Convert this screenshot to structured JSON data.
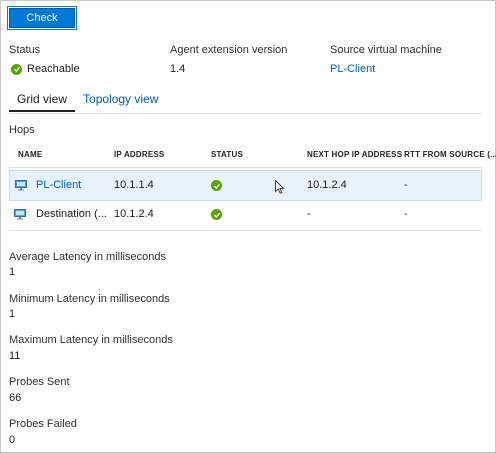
{
  "check_button": "Check",
  "info": {
    "status_label": "Status",
    "status_value": "Reachable",
    "agent_label": "Agent extension version",
    "agent_value": "1.4",
    "source_label": "Source virtual machine",
    "source_value": "PL-Client"
  },
  "tabs": [
    {
      "label": "Grid view"
    },
    {
      "label": "Topology view"
    }
  ],
  "hops_title": "Hops",
  "table": {
    "headers": [
      "NAME",
      "IP ADDRESS",
      "STATUS",
      "NEXT HOP IP ADDRESS",
      "RTT FROM SOURCE (..."
    ],
    "rows": [
      {
        "name": "PL-Client",
        "ip": "10.1.1.4",
        "status": "ok",
        "next_hop": "10.1.2.4",
        "rtt": "-"
      },
      {
        "name": "Destination (...",
        "ip": "10.1.2.4",
        "status": "ok",
        "next_hop": "-",
        "rtt": "-"
      }
    ]
  },
  "stats": [
    {
      "label": "Average Latency in milliseconds",
      "value": "1"
    },
    {
      "label": "Minimum Latency in milliseconds",
      "value": "1"
    },
    {
      "label": "Maximum Latency in milliseconds",
      "value": "11"
    },
    {
      "label": "Probes Sent",
      "value": "66"
    },
    {
      "label": "Probes Failed",
      "value": "0"
    }
  ],
  "colors": {
    "accent": "#0078d4",
    "link": "#0063b1",
    "success": "#57a300",
    "selected_row": "#e9f1fb"
  }
}
